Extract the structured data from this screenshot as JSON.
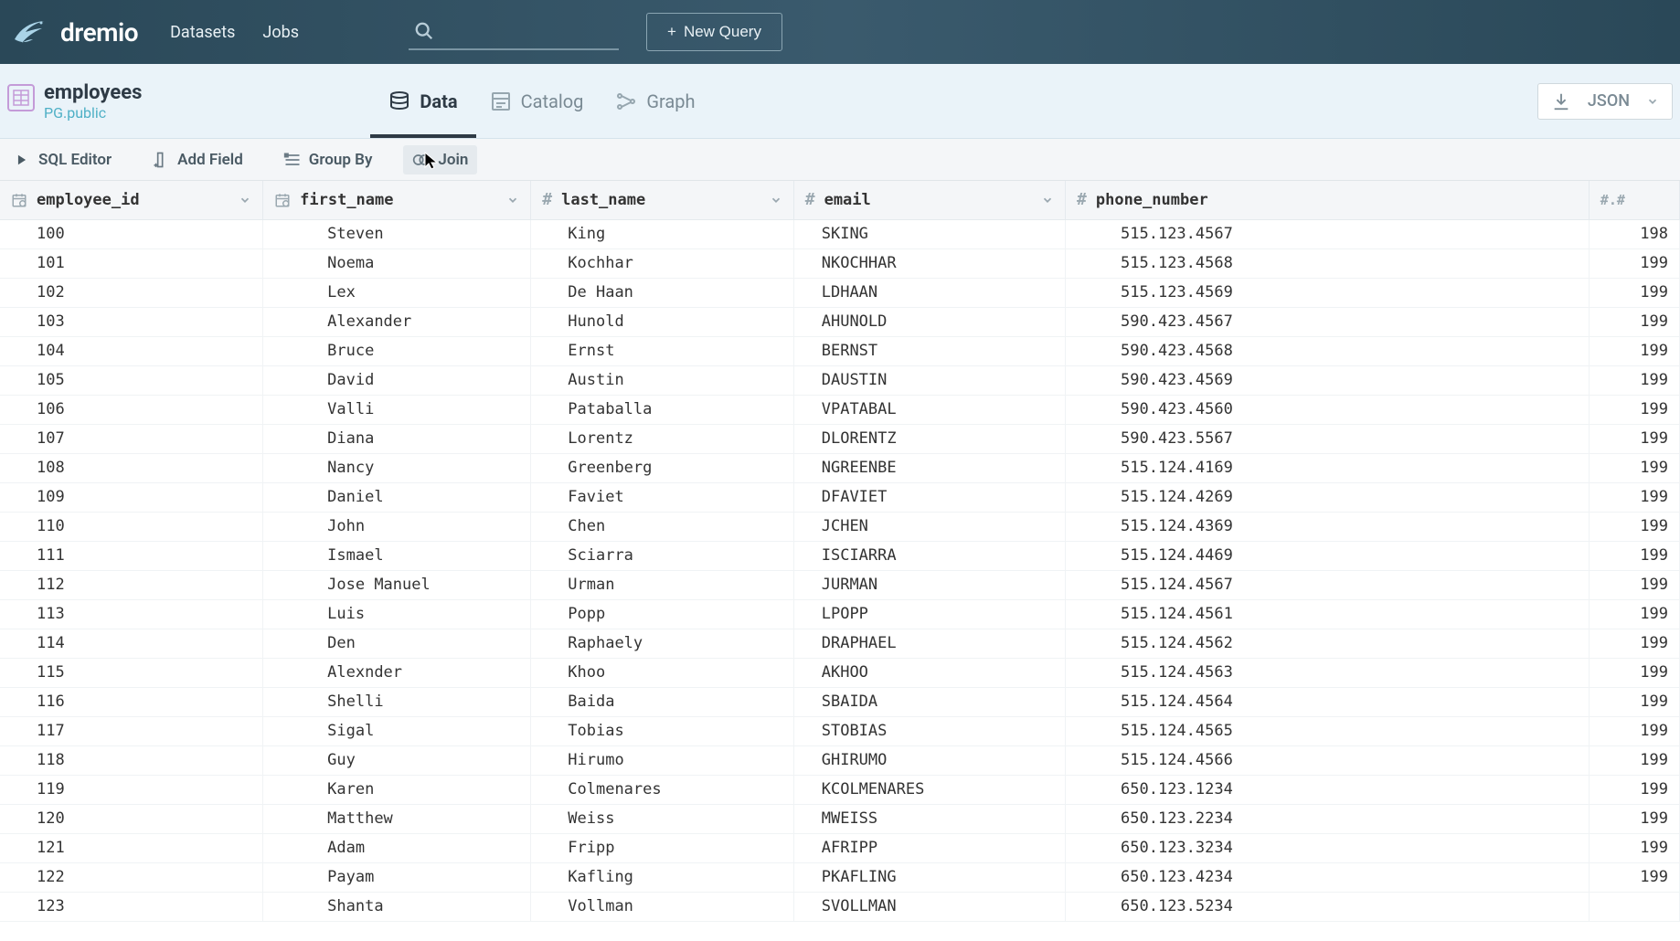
{
  "header": {
    "brand": "dremio",
    "nav": {
      "datasets": "Datasets",
      "jobs": "Jobs"
    },
    "search_placeholder": "",
    "new_query": "New Query"
  },
  "subheader": {
    "table_name": "employees",
    "table_path": "PG.public",
    "tabs": {
      "data": "Data",
      "catalog": "Catalog",
      "graph": "Graph"
    },
    "download_label": "JSON"
  },
  "toolbar": {
    "sql_editor": "SQL Editor",
    "add_field": "Add Field",
    "group_by": "Group By",
    "join": "Join"
  },
  "columns": {
    "employee_id": "employee_id",
    "first_name": "first_name",
    "last_name": "last_name",
    "email": "email",
    "phone_number": "phone_number"
  },
  "rows": [
    {
      "employee_id": "100",
      "first_name": "Steven",
      "last_name": "King",
      "email": "SKING",
      "phone_number": "515.123.4567",
      "extra": "198"
    },
    {
      "employee_id": "101",
      "first_name": "Noema",
      "last_name": "Kochhar",
      "email": "NKOCHHAR",
      "phone_number": "515.123.4568",
      "extra": "199"
    },
    {
      "employee_id": "102",
      "first_name": "Lex",
      "last_name": "De Haan",
      "email": "LDHAAN",
      "phone_number": "515.123.4569",
      "extra": "199"
    },
    {
      "employee_id": "103",
      "first_name": "Alexander",
      "last_name": "Hunold",
      "email": "AHUNOLD",
      "phone_number": "590.423.4567",
      "extra": "199"
    },
    {
      "employee_id": "104",
      "first_name": "Bruce",
      "last_name": "Ernst",
      "email": "BERNST",
      "phone_number": "590.423.4568",
      "extra": "199"
    },
    {
      "employee_id": "105",
      "first_name": "David",
      "last_name": "Austin",
      "email": "DAUSTIN",
      "phone_number": "590.423.4569",
      "extra": "199"
    },
    {
      "employee_id": "106",
      "first_name": "Valli",
      "last_name": "Pataballa",
      "email": "VPATABAL",
      "phone_number": "590.423.4560",
      "extra": "199"
    },
    {
      "employee_id": "107",
      "first_name": "Diana",
      "last_name": "Lorentz",
      "email": "DLORENTZ",
      "phone_number": "590.423.5567",
      "extra": "199"
    },
    {
      "employee_id": "108",
      "first_name": "Nancy",
      "last_name": "Greenberg",
      "email": "NGREENBE",
      "phone_number": "515.124.4169",
      "extra": "199"
    },
    {
      "employee_id": "109",
      "first_name": "Daniel",
      "last_name": "Faviet",
      "email": "DFAVIET",
      "phone_number": "515.124.4269",
      "extra": "199"
    },
    {
      "employee_id": "110",
      "first_name": "John",
      "last_name": "Chen",
      "email": "JCHEN",
      "phone_number": "515.124.4369",
      "extra": "199"
    },
    {
      "employee_id": "111",
      "first_name": "Ismael",
      "last_name": "Sciarra",
      "email": "ISCIARRA",
      "phone_number": "515.124.4469",
      "extra": "199"
    },
    {
      "employee_id": "112",
      "first_name": "Jose Manuel",
      "last_name": "Urman",
      "email": "JURMAN",
      "phone_number": "515.124.4567",
      "extra": "199"
    },
    {
      "employee_id": "113",
      "first_name": "Luis",
      "last_name": "Popp",
      "email": "LPOPP",
      "phone_number": "515.124.4561",
      "extra": "199"
    },
    {
      "employee_id": "114",
      "first_name": "Den",
      "last_name": "Raphaely",
      "email": "DRAPHAEL",
      "phone_number": "515.124.4562",
      "extra": "199"
    },
    {
      "employee_id": "115",
      "first_name": "Alexnder",
      "last_name": "Khoo",
      "email": "AKHOO",
      "phone_number": "515.124.4563",
      "extra": "199"
    },
    {
      "employee_id": "116",
      "first_name": "Shelli",
      "last_name": "Baida",
      "email": "SBAIDA",
      "phone_number": "515.124.4564",
      "extra": "199"
    },
    {
      "employee_id": "117",
      "first_name": "Sigal",
      "last_name": "Tobias",
      "email": "STOBIAS",
      "phone_number": "515.124.4565",
      "extra": "199"
    },
    {
      "employee_id": "118",
      "first_name": "Guy",
      "last_name": "Hirumo",
      "email": "GHIRUMO",
      "phone_number": "515.124.4566",
      "extra": "199"
    },
    {
      "employee_id": "119",
      "first_name": "Karen",
      "last_name": "Colmenares",
      "email": "KCOLMENARES",
      "phone_number": "650.123.1234",
      "extra": "199"
    },
    {
      "employee_id": "120",
      "first_name": "Matthew",
      "last_name": "Weiss",
      "email": "MWEISS",
      "phone_number": "650.123.2234",
      "extra": "199"
    },
    {
      "employee_id": "121",
      "first_name": "Adam",
      "last_name": "Fripp",
      "email": "AFRIPP",
      "phone_number": "650.123.3234",
      "extra": "199"
    },
    {
      "employee_id": "122",
      "first_name": "Payam",
      "last_name": "Kafling",
      "email": "PKAFLING",
      "phone_number": "650.123.4234",
      "extra": "199"
    },
    {
      "employee_id": "123",
      "first_name": "Shanta",
      "last_name": "Vollman",
      "email": "SVOLLMAN",
      "phone_number": "650.123.5234",
      "extra": ""
    }
  ]
}
